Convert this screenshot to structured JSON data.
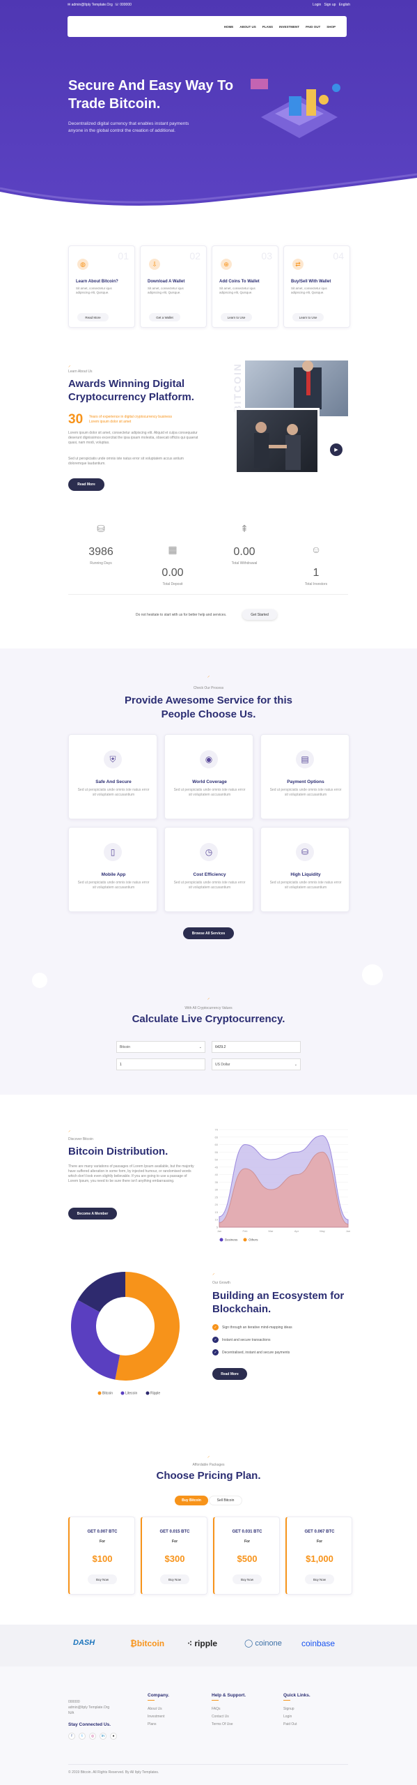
{
  "topbar": {
    "email": "admin@Itply Template.Org",
    "phone": "000000",
    "login": "Login",
    "signup": "Sign up",
    "language": "English"
  },
  "nav": {
    "items": [
      "HOME",
      "ABOUT US",
      "PLANS",
      "INVESTMENT",
      "PAID OUT",
      "SHOP"
    ]
  },
  "hero": {
    "title_line1": "Secure And Easy Way To",
    "title_line2": "Trade Bitcoin.",
    "desc_line1": "Decentralized digital currency that enables instant payments",
    "desc_line2": "anyone in the global control the creation of additional."
  },
  "steps": [
    {
      "num": "01",
      "title": "Learn About Bitcoin?",
      "desc": "Sit amet, consectetur iqus adipiscing elit, Quisque.",
      "btn": "Read More"
    },
    {
      "num": "02",
      "title": "Download A Wallet",
      "desc": "Sit amet, consectetur iqus adipiscing elit, Quisque.",
      "btn": "Get a Wallet"
    },
    {
      "num": "03",
      "title": "Add Coins To Wallet",
      "desc": "Sit amet, consectetur iqus adipiscing elit, Quisque.",
      "btn": "Learn to Use"
    },
    {
      "num": "04",
      "title": "Buy/Sell With Wallet",
      "desc": "Sit amet, consectetur iqus adipiscing elit, Quisque.",
      "btn": "Learn to Use"
    }
  ],
  "about": {
    "eyebrow": "Learn About Us",
    "title_line1": "Awards Winning Digital",
    "title_line2": "Cryptocurrency Platform.",
    "years": "30",
    "years_line1": "Years of experience in digital cryptocurrency business",
    "years_line2": "Lorem ipsum dolor sit amet",
    "para1": "Lorem ipsum dolor sit amet, consectetur adipiscing elit. Aliquid et culpa consequatur deserunt dignissimos excercitat the ipsa ipsam molestia, obsecati officiis qui quaerat quasi, nam modi, voluptas.",
    "para2": "Sed ut perspiciatis unde omnis iste natus error sit voluptatem accus antium doloremque laudantium.",
    "btn": "Read More",
    "vertical": "BITCOIN"
  },
  "stats": [
    {
      "value": "3986",
      "label": "Running Days"
    },
    {
      "value": "0.00",
      "label": "Total Deposit"
    },
    {
      "value": "0.00",
      "label": "Total Withdrawal"
    },
    {
      "value": "1",
      "label": "Total Investors"
    }
  ],
  "cta": {
    "text": "Do not hesitate to start with us for better help and services.",
    "btn": "Get Started"
  },
  "services": {
    "eyebrow": "Check Our Process",
    "title_line1": "Provide Awesome Service for this",
    "title_line2": "People Choose Us.",
    "items": [
      {
        "title": "Safe And Secure",
        "desc": "Sed ut perspiciatis unde omnis iste natus error sit voluptatem accusantium"
      },
      {
        "title": "World Coverage",
        "desc": "Sed ut perspiciatis unde omnis iste natus error sit voluptatem accusantium"
      },
      {
        "title": "Payment Options",
        "desc": "Sed ut perspiciatis unde omnis iste natus error sit voluptatem accusantium"
      },
      {
        "title": "Mobile App",
        "desc": "Sed ut perspiciatis unde omnis iste natus error sit voluptatem accusantium"
      },
      {
        "title": "Cost Efficiency",
        "desc": "Sed ut perspiciatis unde omnis iste natus error sit voluptatem accusantium"
      },
      {
        "title": "High Liquidity",
        "desc": "Sed ut perspiciatis unde omnis iste natus error sit voluptatem accusantium"
      }
    ],
    "btn": "Browse All Services"
  },
  "calc": {
    "eyebrow": "With All Cryptocurrency Values",
    "title": "Calculate Live Cryptocurrency.",
    "coin": "Bitcoin",
    "value": "6429.2",
    "amount": "1",
    "currency": "US Dollar"
  },
  "dist": {
    "eyebrow": "Discover Bitcoin",
    "title": "Bitcoin Distribution.",
    "para": "There are many variations of passages of Lorem Ipsum available, but the majority have suffered alteration in some form, by injected humour, or randomised words which don't look even slightly believable. If you are going to use a passage of Lorem Ipsum, you need to be sure there isn't anything embarrassing.",
    "btn": "Become A Member"
  },
  "ecosystem": {
    "eyebrow": "Our Growth",
    "title_line1": "Building an Ecosystem for",
    "title_line2": "Blockchain.",
    "items": [
      "Sign through an iterative mind-mapping ideas",
      "Instant and secure transactions",
      "Decentralised, instant and secure payments"
    ],
    "btn": "Read More"
  },
  "pricing": {
    "eyebrow": "Affordable Packages",
    "title": "Choose Pricing Plan.",
    "tab_buy": "Buy Bitcoin",
    "tab_sell": "Sell Bitcoin",
    "plans": [
      {
        "name": "GET 0.007 BTC",
        "label": "For",
        "price": "$100",
        "btn": "Buy Now"
      },
      {
        "name": "GET 0.015 BTC",
        "label": "For",
        "price": "$300",
        "btn": "Buy Now"
      },
      {
        "name": "GET 0.031 BTC",
        "label": "For",
        "price": "$500",
        "btn": "Buy Now"
      },
      {
        "name": "GET 0.067 BTC",
        "label": "For",
        "price": "$1,000",
        "btn": "Buy Now"
      }
    ]
  },
  "partners": [
    "DASH",
    "bitcoin",
    "ripple",
    "coinone",
    "coinbase"
  ],
  "footer": {
    "phone": "000000",
    "email": "admin@Itply Template.Org",
    "address": "N/A",
    "connect": "Stay Connected Us.",
    "col1_title": "Company.",
    "col1": [
      "About Us",
      "Investment",
      "Plans"
    ],
    "col2_title": "Help & Support.",
    "col2": [
      "FAQs",
      "Contact Us",
      "Terms Of Use"
    ],
    "col3_title": "Quick Links.",
    "col3": [
      "Signup",
      "Login",
      "Paid Out"
    ],
    "copyright": "© 2019 Bitcoin. All Rights Reserved. By All Itply Templates."
  },
  "chart_data": [
    {
      "type": "area",
      "categories": [
        "Jan",
        "Feb",
        "Mar",
        "Apr",
        "May",
        "Jun"
      ],
      "ylim": [
        5,
        70
      ],
      "yticks": [
        5,
        10,
        15,
        20,
        25,
        30,
        35,
        40,
        45,
        50,
        55,
        60,
        65,
        70
      ],
      "series": [
        {
          "name": "Business",
          "values": [
            12,
            60,
            50,
            55,
            66,
            10
          ],
          "color": "#c9c0ee"
        },
        {
          "name": "Others",
          "values": [
            8,
            44,
            30,
            40,
            55,
            7
          ],
          "color": "#e7a9a9"
        }
      ],
      "legend": "bottom-left"
    },
    {
      "type": "pie",
      "labels": [
        "Bitcoin",
        "Litecoin",
        "Ripple"
      ],
      "values": [
        53,
        30,
        17
      ],
      "colors": [
        "#f7931a",
        "#5a3fc0",
        "#2e2a6e"
      ],
      "legend": "bottom"
    }
  ],
  "colors": {
    "purple": "#5a3fc0",
    "navy": "#2b2d72",
    "orange": "#f7931a"
  }
}
